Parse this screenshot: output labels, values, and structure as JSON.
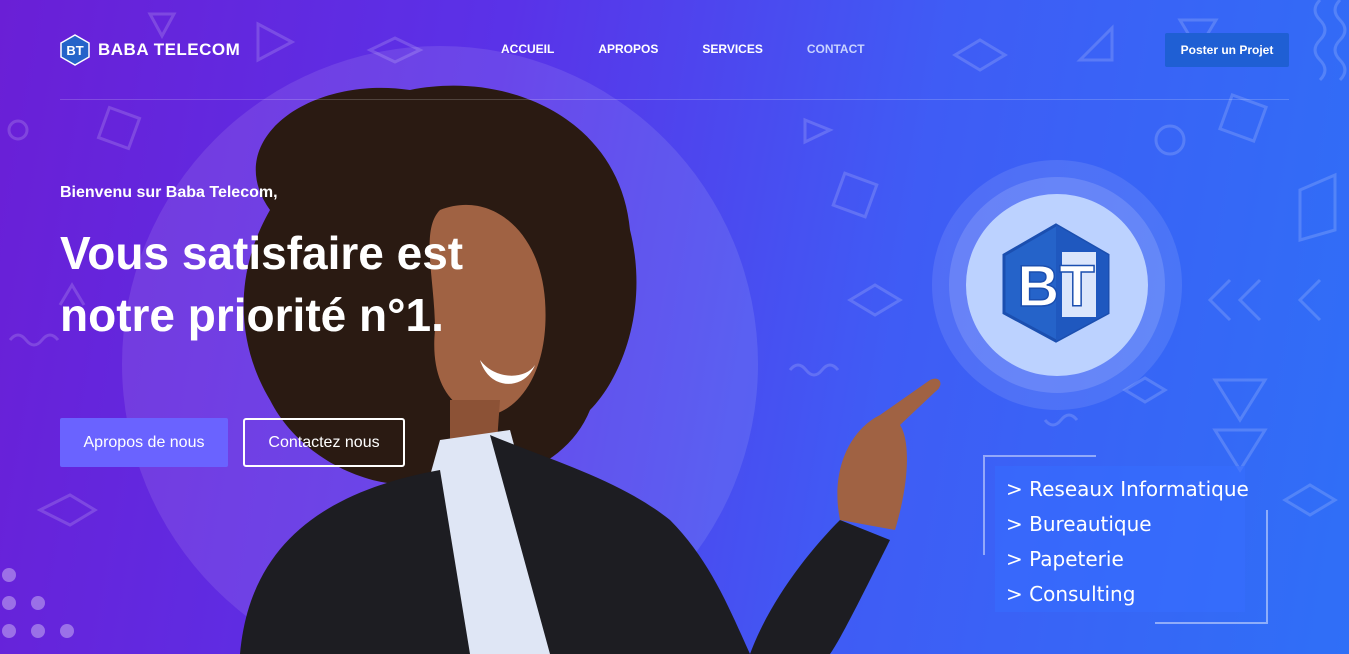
{
  "brand": {
    "name": "BABA TELECOM",
    "logo_initials": "BT",
    "colors": {
      "bg_start": "#6a1fd6",
      "bg_end": "#2f6ff7",
      "logo_blue": "#2563c9",
      "cta": "#1f5fd4",
      "primary_btn": "#6a63ff"
    }
  },
  "nav": {
    "items": [
      {
        "label": "ACCUEIL"
      },
      {
        "label": "APROPOS"
      },
      {
        "label": "SERVICES"
      },
      {
        "label": "CONTACT"
      }
    ],
    "cta_label": "Poster un Projet"
  },
  "hero": {
    "welcome": "Bienvenu sur Baba Telecom,",
    "headline_line1": "Vous satisfaire est",
    "headline_line2": "notre priorité n°1.",
    "primary_button": "Apropos de nous",
    "secondary_button": "Contactez nous"
  },
  "badge": {
    "initials": "BT"
  },
  "services": [
    {
      "label": "> Reseaux Informatique"
    },
    {
      "label": "> Bureautique"
    },
    {
      "label": "> Papeterie"
    },
    {
      "label": "> Consulting"
    }
  ]
}
